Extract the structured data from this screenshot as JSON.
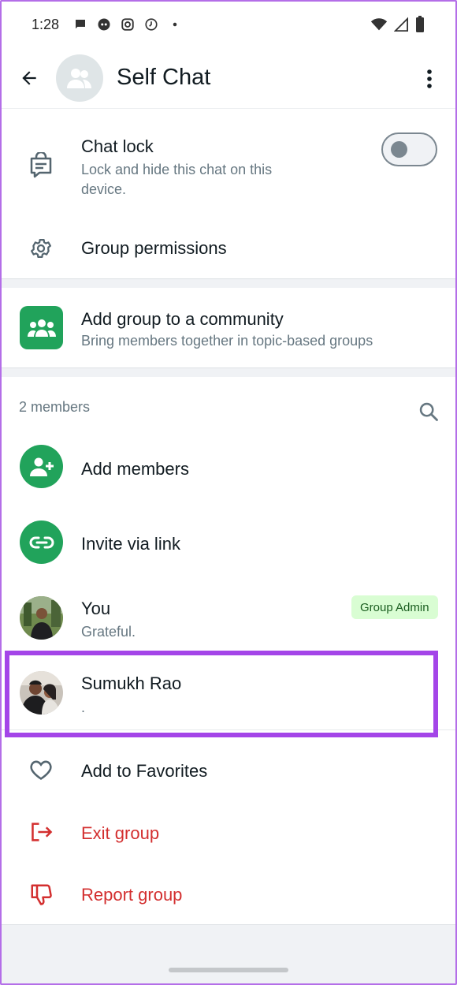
{
  "status_bar": {
    "time": "1:28",
    "notification_icons": [
      "chat-bubble-icon",
      "messenger-icon",
      "instagram-icon",
      "history-icon",
      "dot-icon"
    ],
    "system_icons": [
      "wifi-icon",
      "signal-icon",
      "battery-icon"
    ]
  },
  "header": {
    "title": "Self Chat",
    "back_icon": "arrow-left-icon",
    "more_icon": "more-vert-icon"
  },
  "settings": {
    "chat_lock": {
      "title": "Chat lock",
      "subtitle": "Lock and hide this chat on this device.",
      "toggle_on": false
    },
    "group_permissions": {
      "title": "Group permissions"
    }
  },
  "community": {
    "title": "Add group to a community",
    "subtitle": "Bring members together in topic-based groups"
  },
  "members": {
    "count_label": "2 members",
    "add_members_label": "Add members",
    "invite_label": "Invite via link",
    "list": [
      {
        "name": "You",
        "status": "Grateful.",
        "badge": "Group Admin"
      },
      {
        "name": "Sumukh Rao",
        "status": "."
      }
    ]
  },
  "actions": {
    "favorites": "Add to Favorites",
    "exit": "Exit group",
    "report": "Report group"
  },
  "colors": {
    "accent_green": "#21a35b",
    "danger_red": "#d32f2f",
    "highlight_purple": "#a445e8",
    "admin_badge_bg": "#d9fdd3"
  }
}
